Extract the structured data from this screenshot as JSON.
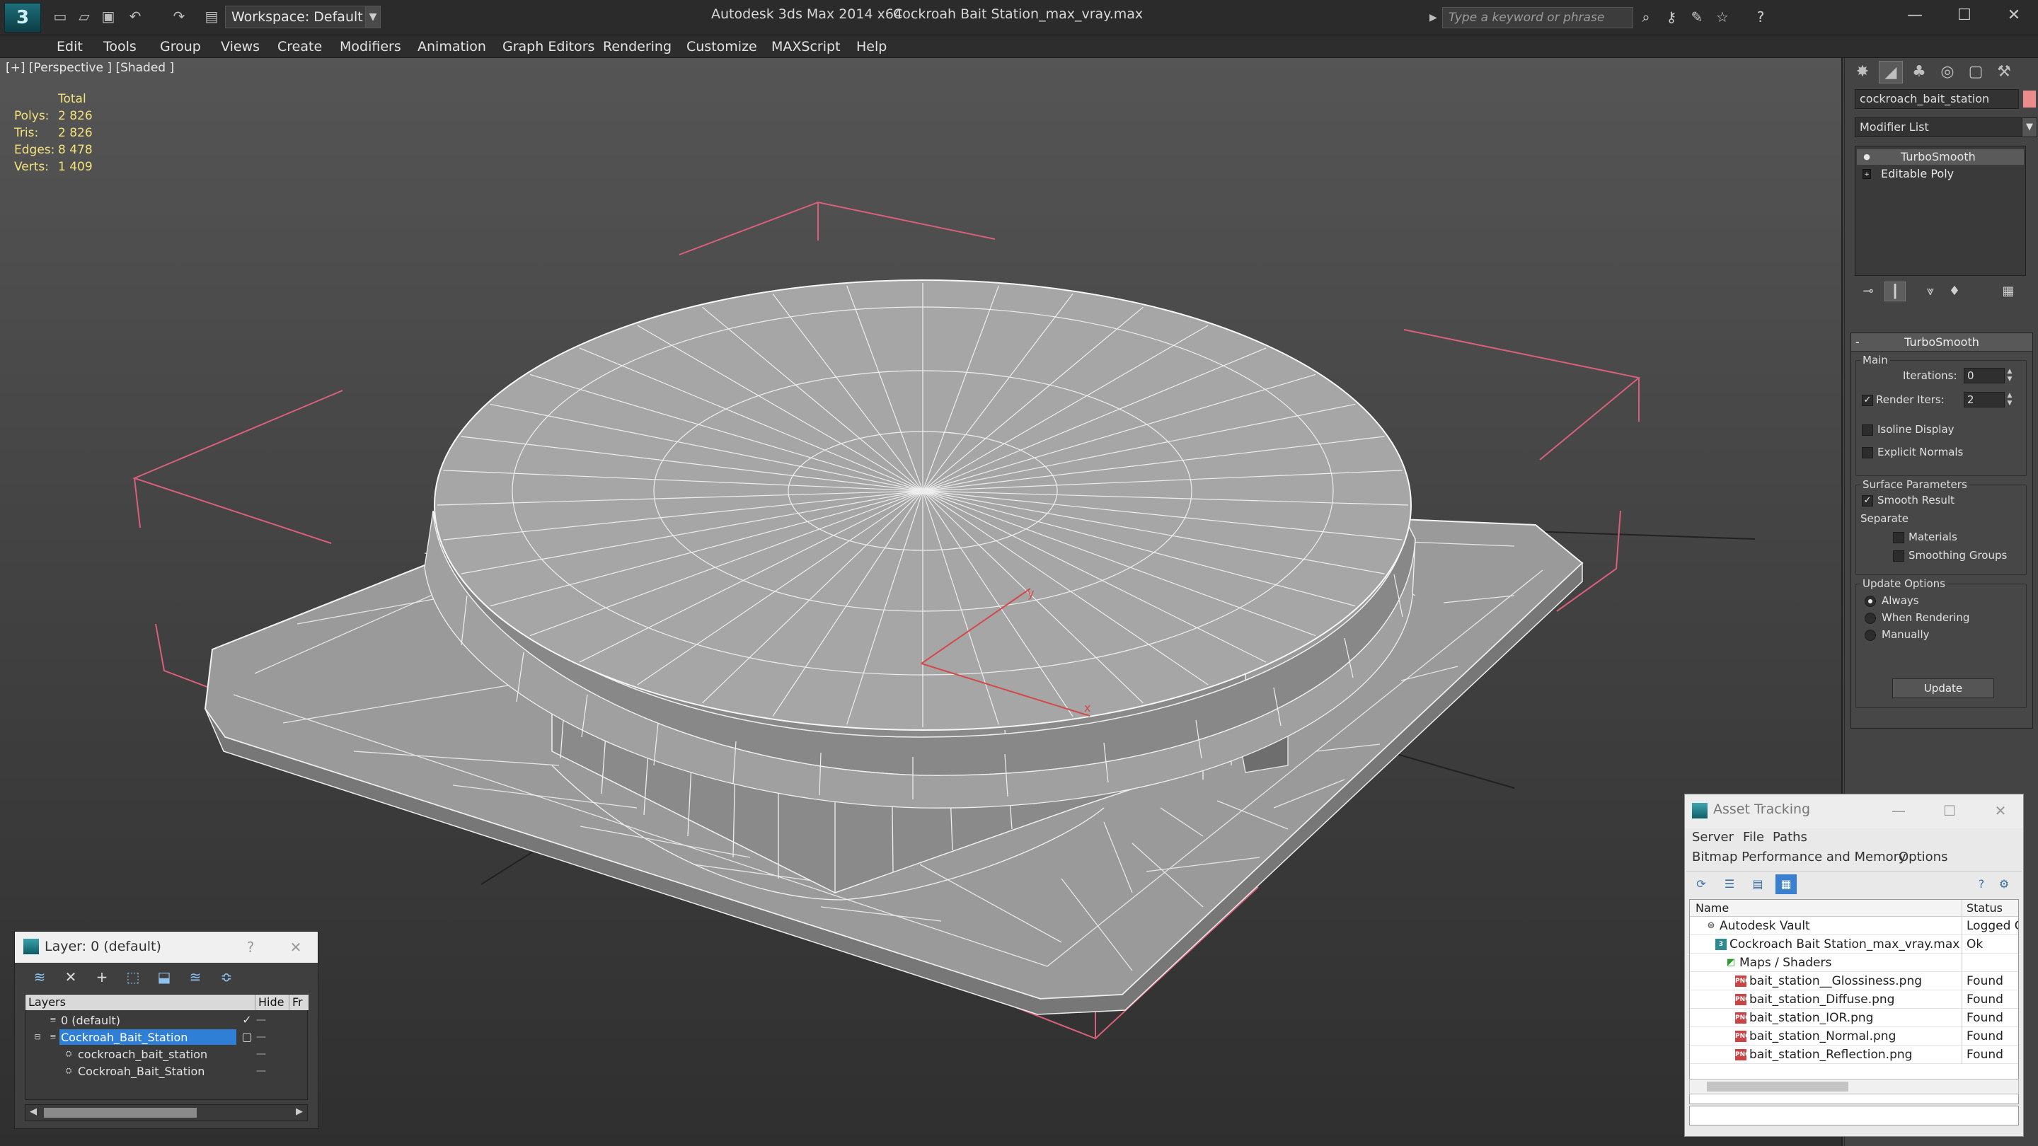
{
  "titlebar": {
    "workspace": "Workspace: Default",
    "app_title": "Autodesk 3ds Max  2014 x64",
    "file_title": "Cockroah Bait Station_max_vray.max",
    "search_placeholder": "Type a keyword or phrase"
  },
  "menu": [
    "Edit",
    "Tools",
    "Group",
    "Views",
    "Create",
    "Modifiers",
    "Animation",
    "Graph Editors",
    "Rendering",
    "Customize",
    "MAXScript",
    "Help"
  ],
  "viewport": {
    "label": "[+] [Perspective ] [Shaded ]",
    "stats": {
      "header": "Total",
      "rows": [
        {
          "label": "Polys:",
          "value": "2 826"
        },
        {
          "label": "Tris:",
          "value": "2 826"
        },
        {
          "label": "Edges:",
          "value": "8 478"
        },
        {
          "label": "Verts:",
          "value": "1 409"
        }
      ]
    },
    "gizmo_x": "x",
    "gizmo_y": "y"
  },
  "command_panel": {
    "object_name": "cockroach_bait_station",
    "object_color": "#ec8b8b",
    "modifier_list": "Modifier List",
    "stack": [
      {
        "label": "TurboSmooth"
      },
      {
        "label": "Editable Poly"
      }
    ],
    "turbosmooth": {
      "title": "TurboSmooth",
      "main_group": "Main",
      "iterations_label": "Iterations:",
      "iterations": "0",
      "render_iters_label": "Render Iters:",
      "render_iters": "2",
      "isoline": "Isoline Display",
      "explicit_normals": "Explicit Normals",
      "surface_group": "Surface Parameters",
      "smooth_result": "Smooth Result",
      "separate": "Separate",
      "materials": "Materials",
      "smoothing_groups": "Smoothing Groups",
      "update_group": "Update Options",
      "always": "Always",
      "when_rendering": "When Rendering",
      "manually": "Manually",
      "update_button": "Update"
    }
  },
  "asset_tracking": {
    "title": "Asset Tracking",
    "menu_row1": [
      "Server",
      "File",
      "Paths"
    ],
    "menu_row2": [
      "Bitmap Performance and Memory",
      "Options"
    ],
    "columns": {
      "name": "Name",
      "status": "Status"
    },
    "rows": [
      {
        "name": "Autodesk Vault",
        "status": "Logged Out"
      },
      {
        "name": "Cockroach Bait Station_max_vray.max",
        "status": "Ok"
      },
      {
        "name": "Maps / Shaders",
        "status": ""
      },
      {
        "name": "bait_station__Glossiness.png",
        "status": "Found"
      },
      {
        "name": "bait_station_Diffuse.png",
        "status": "Found"
      },
      {
        "name": "bait_station_IOR.png",
        "status": "Found"
      },
      {
        "name": "bait_station_Normal.png",
        "status": "Found"
      },
      {
        "name": "bait_station_Reflection.png",
        "status": "Found"
      }
    ]
  },
  "layer_window": {
    "title": "Layer: 0 (default)",
    "help": "?",
    "columns": {
      "layers": "Layers",
      "hide": "Hide",
      "freeze": "Fr"
    },
    "rows": [
      {
        "name": "0 (default)"
      },
      {
        "name": "Cockroah_Bait_Station"
      },
      {
        "name": "cockroach_bait_station"
      },
      {
        "name": "Cockroah_Bait_Station"
      }
    ]
  }
}
